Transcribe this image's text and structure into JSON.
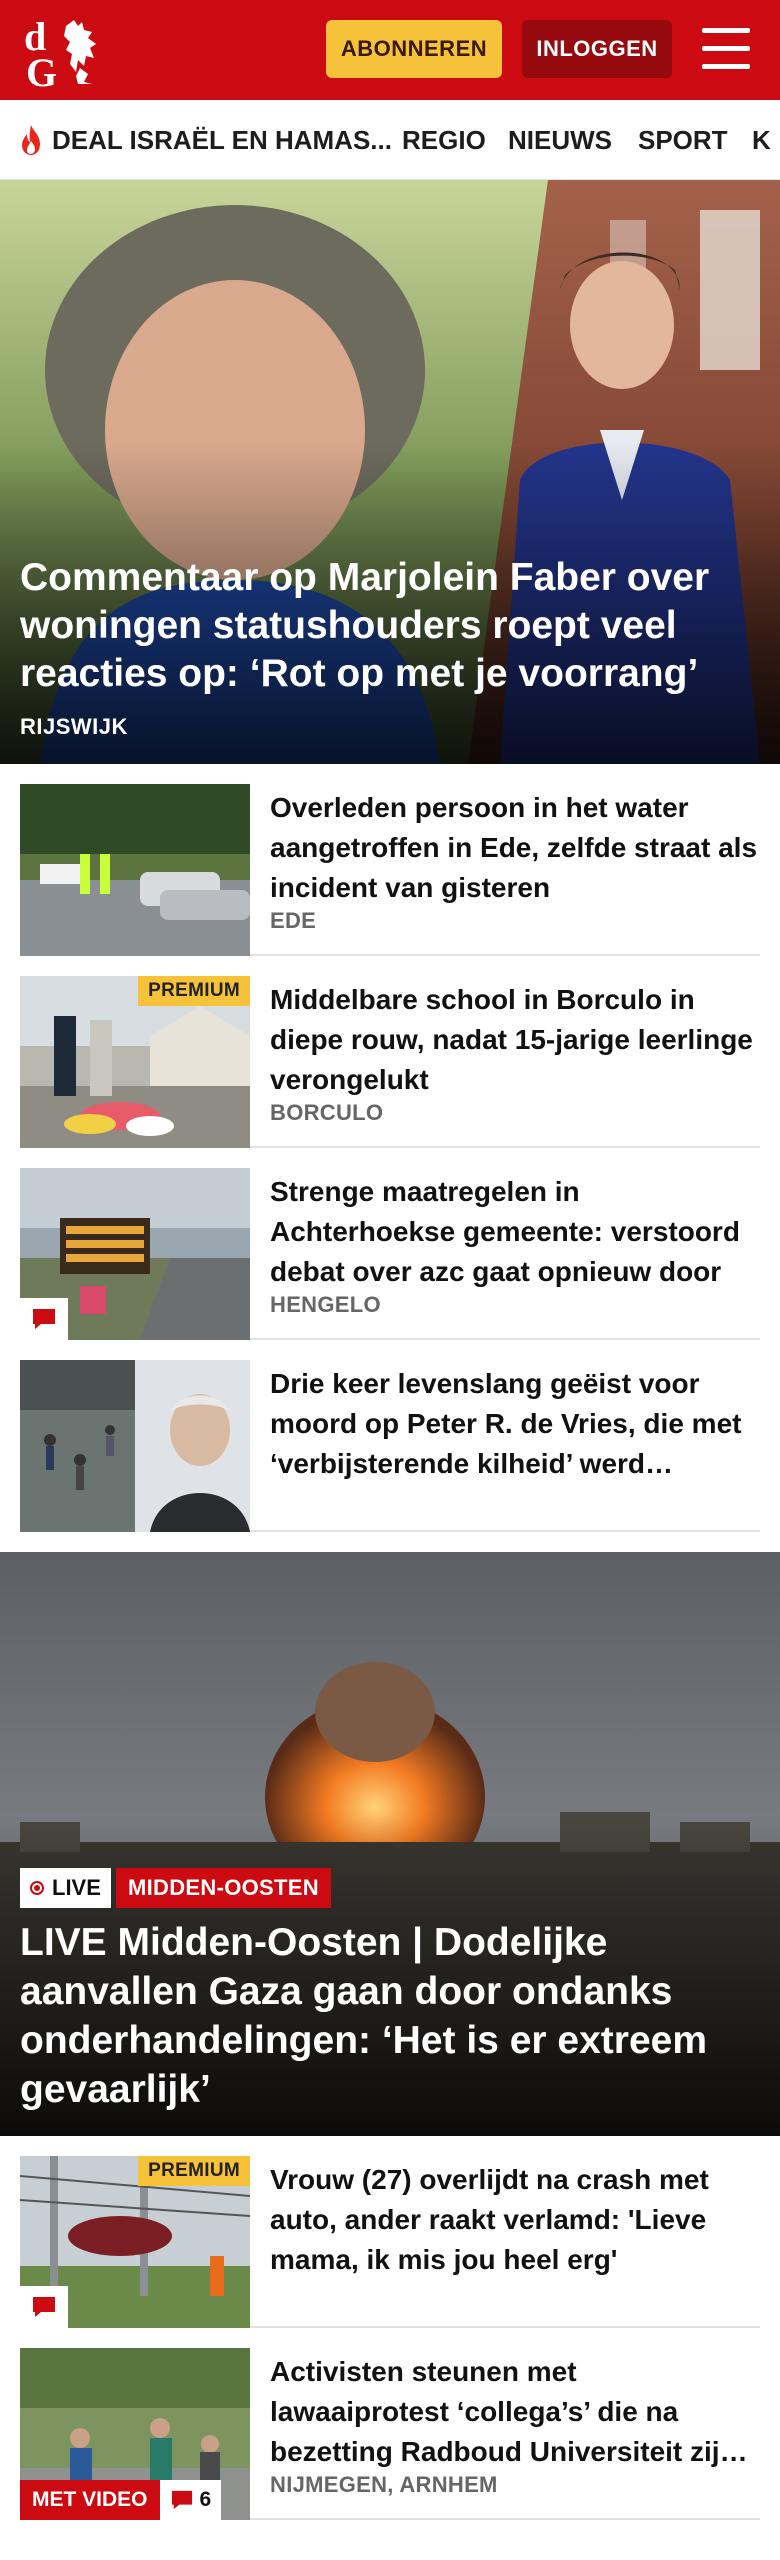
{
  "header": {
    "logo_text": "dG",
    "subscribe_label": "ABONNEREN",
    "login_label": "INLOGGEN",
    "brand_color": "#cc0a12"
  },
  "nav": {
    "items": [
      {
        "label": "DEAL ISRAËL EN HAMAS...",
        "icon": "flame-icon"
      },
      {
        "label": "REGIO"
      },
      {
        "label": "NIEUWS"
      },
      {
        "label": "SPORT"
      },
      {
        "label": "K"
      }
    ]
  },
  "hero": {
    "title": "Commentaar op Marjolein Faber over woningen statushouders roept veel reacties op: ‘Rot op met je voorrang’",
    "location": "RIJSWIJK"
  },
  "articles": [
    {
      "title": "Overleden persoon in het water aangetroffen in Ede, zelfde straat als incident van gisteren",
      "location": "EDE"
    },
    {
      "title": "Middelbare school in Borculo in diepe rouw, nadat 15-jarige leerlinge verongelukt",
      "location": "BORCULO",
      "badge": "PREMIUM"
    },
    {
      "title": "Strenge maatregelen in Achterhoekse gemeente: verstoord debat over azc gaat opnieuw door",
      "location": "HENGELO"
    },
    {
      "title": "Drie keer levenslang geëist voor moord op Peter R. de Vries, die met ‘verbijsterende kilheid’ werd gepleegd",
      "location": ""
    }
  ],
  "hero2": {
    "live_label": "LIVE",
    "topic": "MIDDEN-OOSTEN",
    "title": "LIVE Midden-Oosten | Dodelijke aanvallen Gaza gaan door ondanks onderhandelingen: ‘Het is er extreem gevaarlijk’"
  },
  "articles2": [
    {
      "title": "Vrouw (27) overlijdt na crash met auto, ander raakt verlamd: 'Lieve mama, ik mis jou heel erg'",
      "location": "",
      "badge": "PREMIUM"
    },
    {
      "title": "Activisten steunen met lawaaiprotest ‘collega’s’ die na bezetting Radboud Universiteit zijn opgepakt",
      "location": "NIJMEGEN, ARNHEM",
      "video_label": "MET VIDEO",
      "comment_count": "6"
    }
  ]
}
